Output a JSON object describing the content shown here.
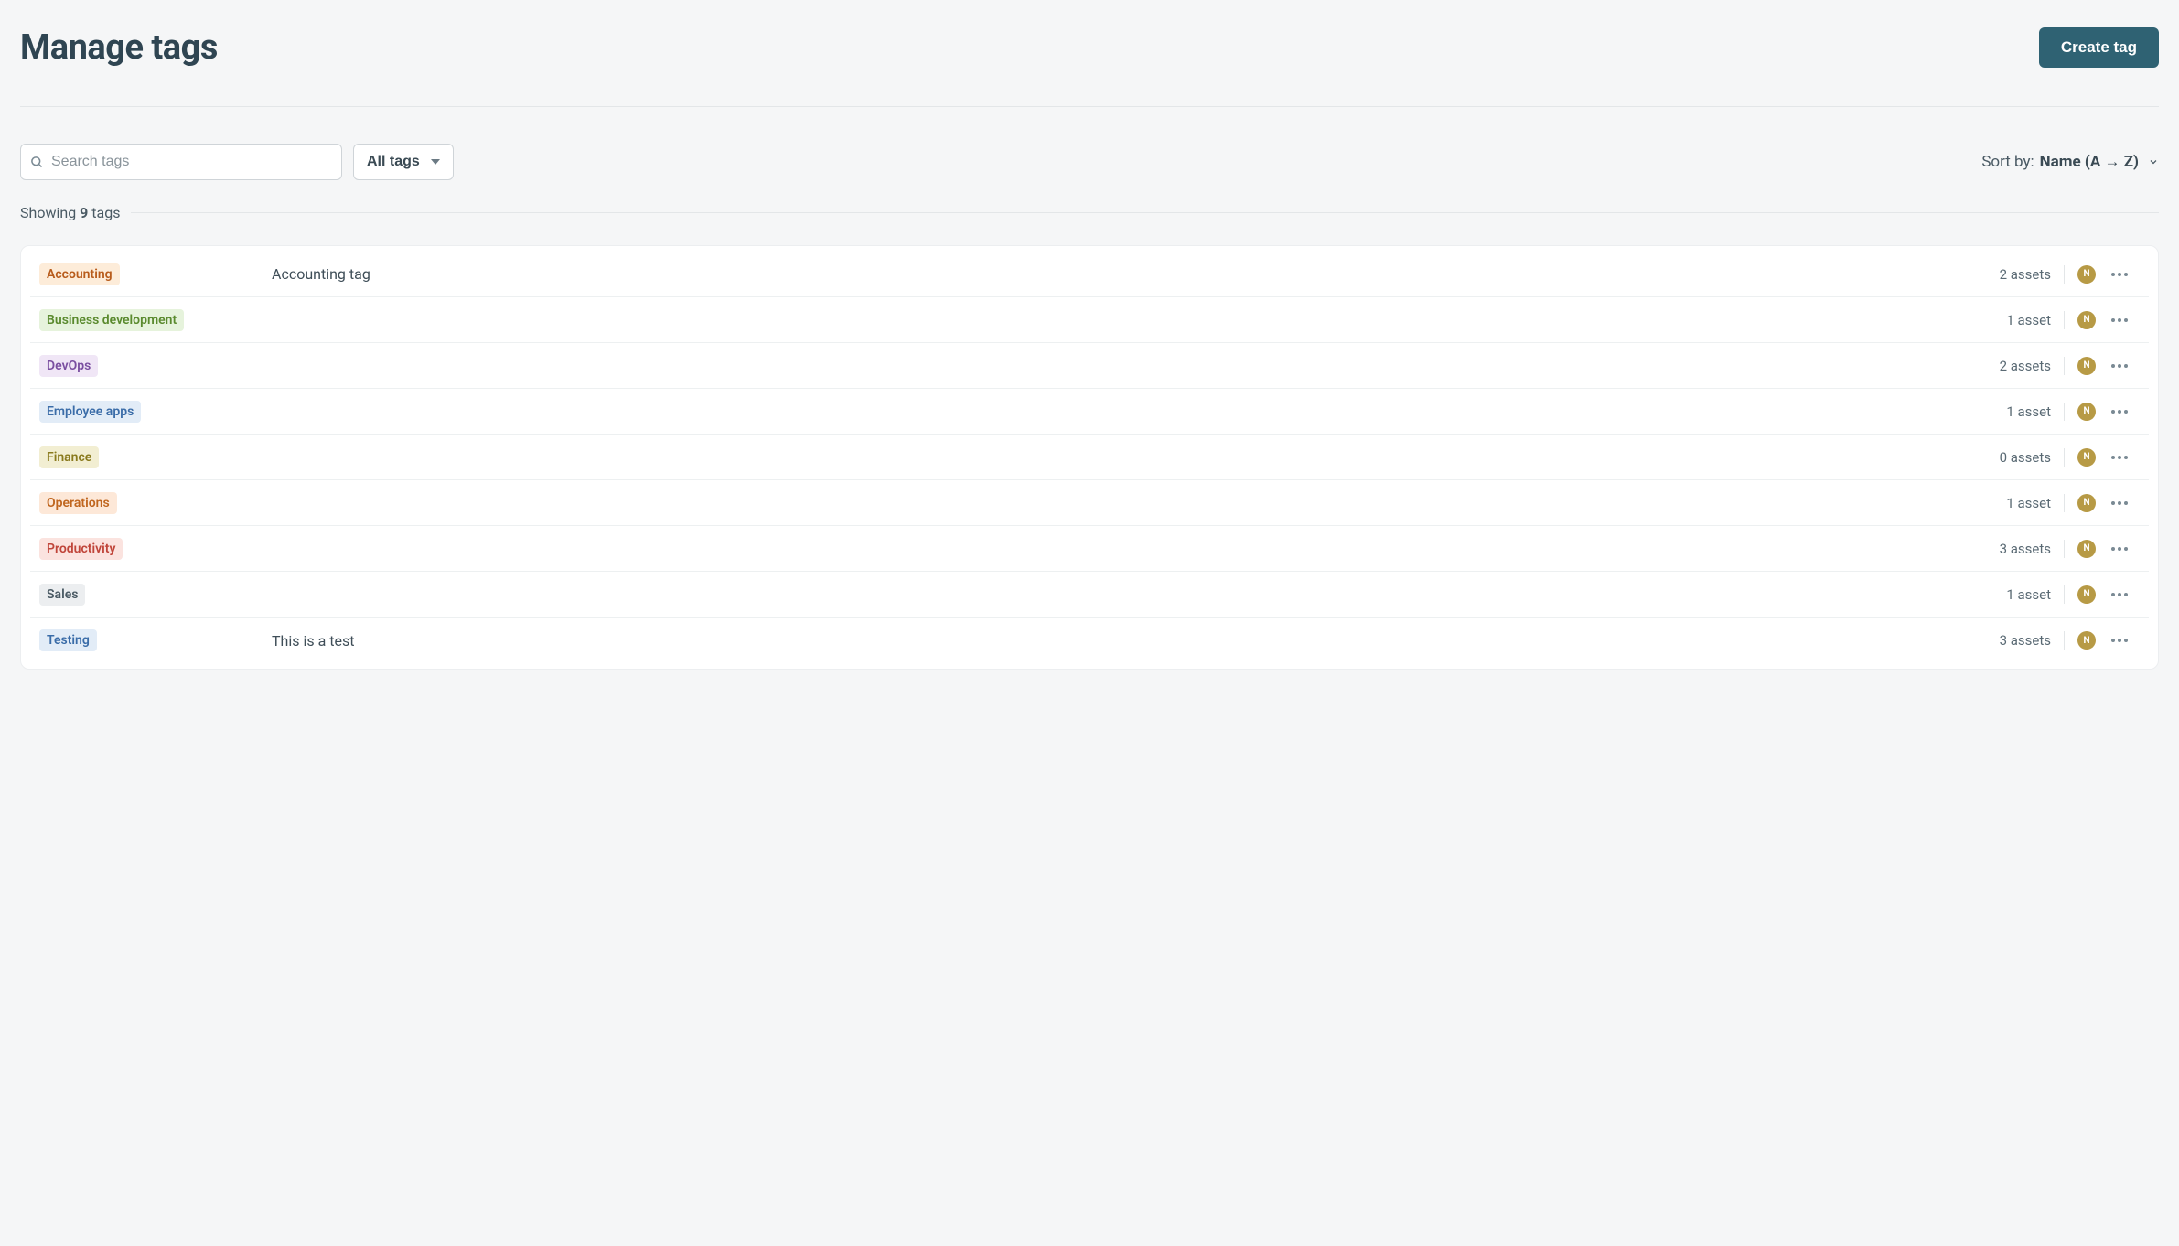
{
  "header": {
    "title": "Manage tags",
    "create_label": "Create tag"
  },
  "search": {
    "placeholder": "Search tags",
    "value": ""
  },
  "filter": {
    "label": "All tags"
  },
  "sort": {
    "prefix": "Sort by:",
    "value": "Name (A → Z)"
  },
  "count": {
    "prefix": "Showing",
    "number": "9",
    "suffix": "tags"
  },
  "avatar_initial": "N",
  "tags": [
    {
      "name": "Accounting",
      "color": "c-orange",
      "description": "Accounting tag",
      "assets": "2 assets"
    },
    {
      "name": "Business development",
      "color": "c-green",
      "description": "",
      "assets": "1 asset"
    },
    {
      "name": "DevOps",
      "color": "c-purple",
      "description": "",
      "assets": "2 assets"
    },
    {
      "name": "Employee apps",
      "color": "c-blue",
      "description": "",
      "assets": "1 asset"
    },
    {
      "name": "Finance",
      "color": "c-olive",
      "description": "",
      "assets": "0 assets"
    },
    {
      "name": "Operations",
      "color": "c-orange2",
      "description": "",
      "assets": "1 asset"
    },
    {
      "name": "Productivity",
      "color": "c-red",
      "description": "",
      "assets": "3 assets"
    },
    {
      "name": "Sales",
      "color": "c-gray",
      "description": "",
      "assets": "1 asset"
    },
    {
      "name": "Testing",
      "color": "c-blue2",
      "description": "This is a test",
      "assets": "3 assets"
    }
  ]
}
